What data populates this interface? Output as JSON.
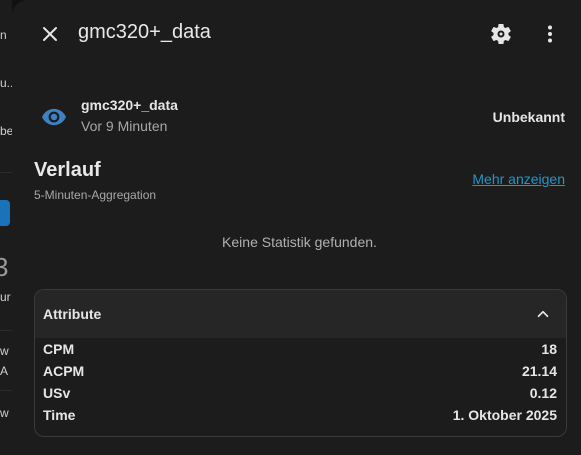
{
  "background": {
    "fragments": [
      "n",
      "u..",
      "be",
      "ur",
      "w",
      "A",
      "w"
    ],
    "big_glyph": "3"
  },
  "header": {
    "title": "gmc320+_data"
  },
  "entity": {
    "name": "gmc320+_data",
    "last_changed": "Vor 9 Minuten",
    "state": "Unbekannt",
    "icon": "eye-icon",
    "icon_color": "#3d83c4"
  },
  "history": {
    "title": "Verlauf",
    "subtitle": "5-Minuten-Aggregation",
    "more_link": "Mehr anzeigen",
    "empty_message": "Keine Statistik gefunden."
  },
  "attributes": {
    "header_label": "Attribute",
    "rows": [
      {
        "key": "CPM",
        "value": "18"
      },
      {
        "key": "ACPM",
        "value": "21.14"
      },
      {
        "key": "USv",
        "value": "0.12"
      },
      {
        "key": "Time",
        "value": "1. Oktober 2025"
      }
    ]
  },
  "colors": {
    "dialog_bg": "#1c1c1c",
    "link": "#2196c9",
    "accent_blue": "#1a73b8"
  }
}
